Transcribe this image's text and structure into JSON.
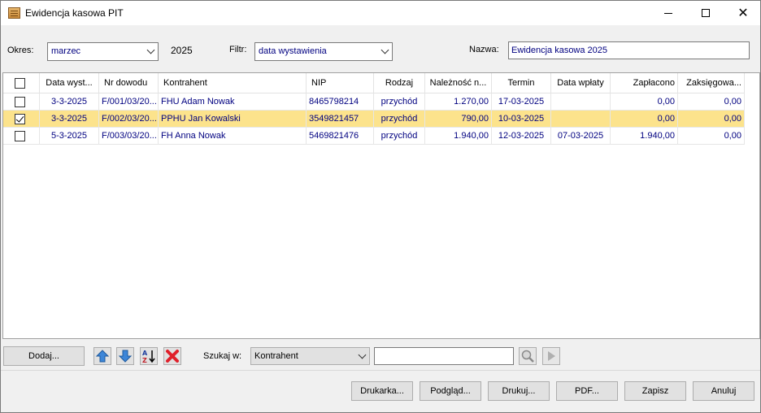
{
  "window": {
    "title": "Ewidencja kasowa PIT"
  },
  "filters": {
    "okres_label": "Okres:",
    "okres_value": "marzec",
    "year": "2025",
    "filtr_label": "Filtr:",
    "filtr_value": "data wystawienia",
    "nazwa_label": "Nazwa:",
    "nazwa_value": "Ewidencja kasowa 2025"
  },
  "table": {
    "headers": [
      "Data wyst...",
      "Nr dowodu",
      "Kontrahent",
      "NIP",
      "Rodzaj",
      "Należność n...",
      "Termin",
      "Data wpłaty",
      "Zapłacono",
      "Zaksięgowa..."
    ],
    "rows": [
      {
        "checked": false,
        "selected": false,
        "cells": [
          "3-3-2025",
          "F/001/03/20...",
          "FHU Adam Nowak",
          "8465798214",
          "przychód",
          "1.270,00",
          "17-03-2025",
          "",
          "0,00",
          "0,00"
        ]
      },
      {
        "checked": true,
        "selected": true,
        "cells": [
          "3-3-2025",
          "F/002/03/20...",
          "PPHU Jan Kowalski",
          "3549821457",
          "przychód",
          "790,00",
          "10-03-2025",
          "",
          "0,00",
          "0,00"
        ]
      },
      {
        "checked": false,
        "selected": false,
        "cells": [
          "5-3-2025",
          "F/003/03/20...",
          "FH Anna Nowak",
          "5469821476",
          "przychód",
          "1.940,00",
          "12-03-2025",
          "07-03-2025",
          "1.940,00",
          "0,00"
        ]
      }
    ]
  },
  "toolbar": {
    "add_label": "Dodaj...",
    "search_label": "Szukaj w:",
    "search_field": "Kontrahent",
    "search_text": "",
    "icons": {
      "up": "arrow-up-icon",
      "down": "arrow-down-icon",
      "sort": "sort-az-icon",
      "delete": "delete-x-icon",
      "search": "magnifier-icon",
      "next": "play-next-icon"
    }
  },
  "footer": {
    "drukarka": "Drukarka...",
    "podglad": "Podgląd...",
    "drukuj": "Drukuj...",
    "pdf": "PDF...",
    "zapisz": "Zapisz",
    "anuluj": "Anuluj"
  },
  "colors": {
    "selected_row": "#fce38c",
    "data_text": "#000080"
  }
}
